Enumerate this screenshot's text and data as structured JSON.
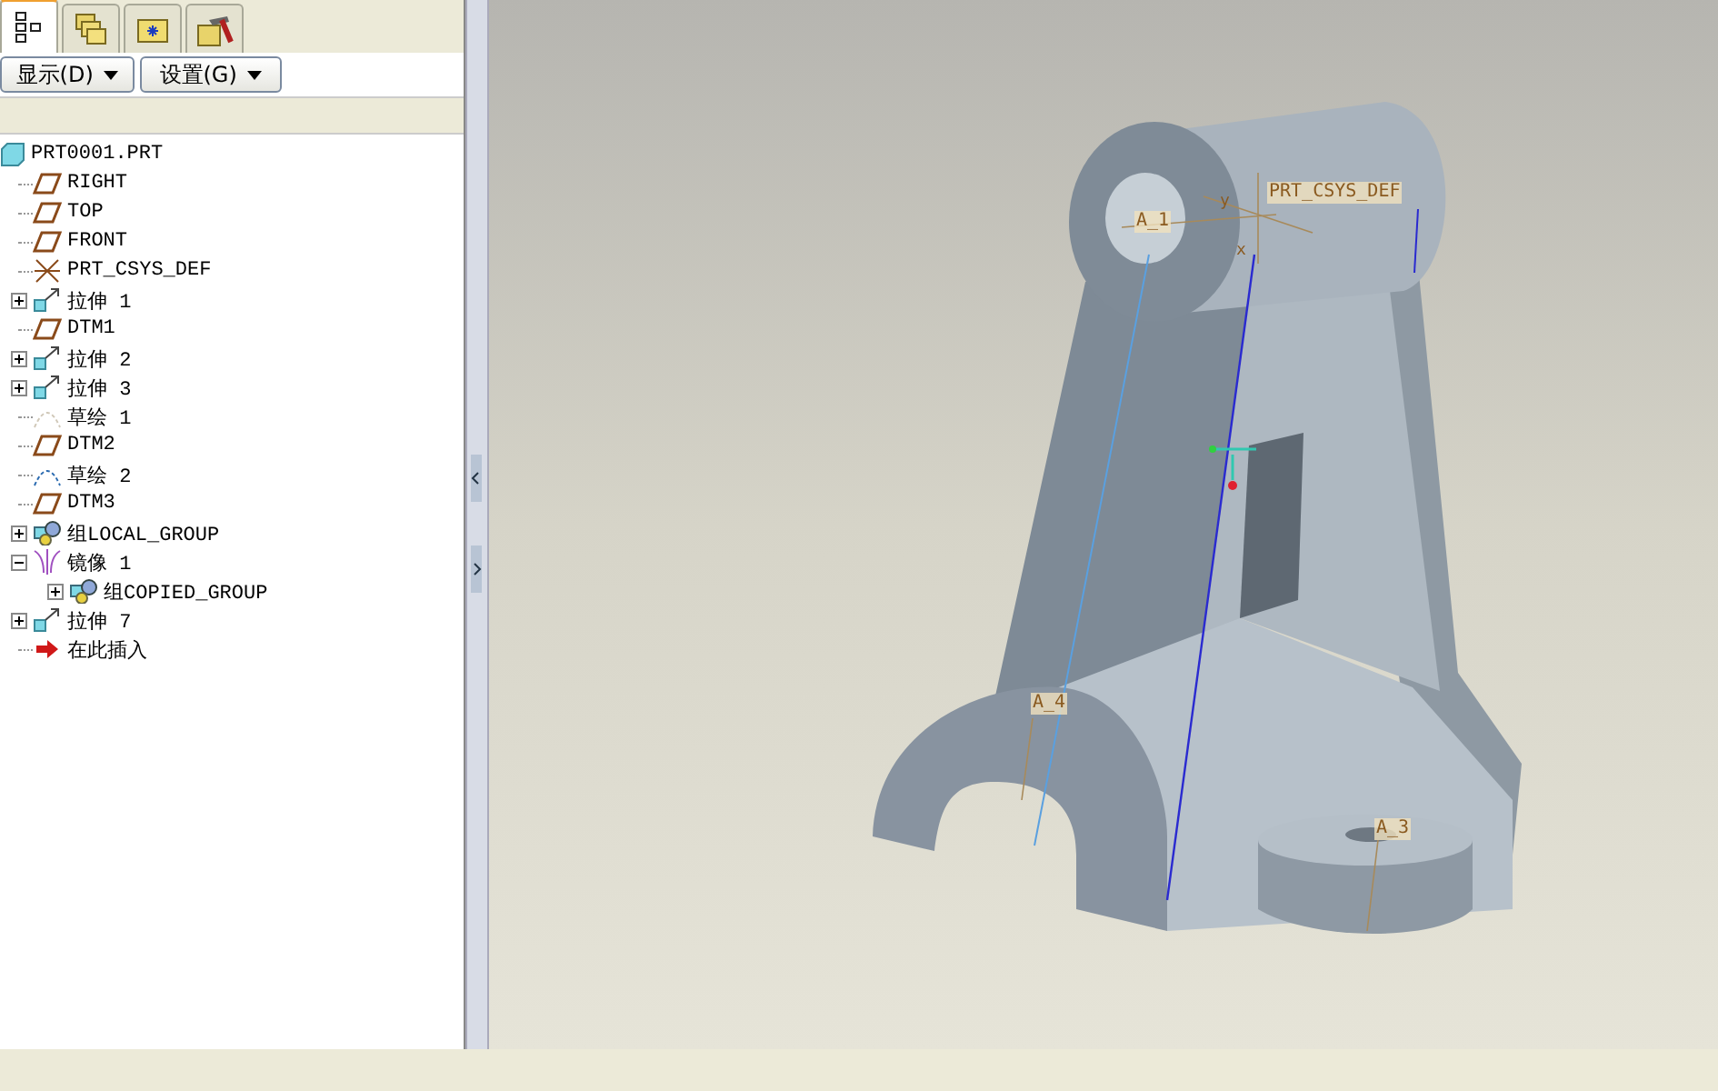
{
  "tabs": [
    {
      "kind": "tree",
      "selected": true
    },
    {
      "kind": "folders",
      "selected": false
    },
    {
      "kind": "favorites",
      "selected": false
    },
    {
      "kind": "tools",
      "selected": false
    }
  ],
  "toolbar": {
    "buttons": [
      "显示(D)",
      "设置(G)"
    ]
  },
  "tree": {
    "label": "PRT0001.PRT",
    "kind": "part",
    "children": [
      {
        "label": "RIGHT",
        "kind": "plane"
      },
      {
        "label": "TOP",
        "kind": "plane"
      },
      {
        "label": "FRONT",
        "kind": "plane"
      },
      {
        "label": "PRT_CSYS_DEF",
        "kind": "csys"
      },
      {
        "label": "拉伸 1",
        "kind": "extrude",
        "expanded": false
      },
      {
        "label": "DTM1",
        "kind": "plane"
      },
      {
        "label": "拉伸 2",
        "kind": "extrude",
        "expanded": false
      },
      {
        "label": "拉伸 3",
        "kind": "extrude",
        "expanded": false
      },
      {
        "label": "草绘 1",
        "kind": "sketch-hidden"
      },
      {
        "label": "DTM2",
        "kind": "plane"
      },
      {
        "label": "草绘 2",
        "kind": "sketch"
      },
      {
        "label": "DTM3",
        "kind": "plane"
      },
      {
        "label": "组LOCAL_GROUP",
        "kind": "group",
        "expanded": false
      },
      {
        "label": "镜像 1",
        "kind": "mirror",
        "expanded": true,
        "children": [
          {
            "label": "组COPIED_GROUP",
            "kind": "group",
            "expanded": false
          }
        ]
      },
      {
        "label": "拉伸 7",
        "kind": "extrude",
        "expanded": false
      },
      {
        "label": "在此插入",
        "kind": "insert"
      }
    ]
  },
  "viewport": {
    "labels": [
      {
        "text": "A_1",
        "kind": "axis"
      },
      {
        "text": "PRT_CSYS_DEF",
        "kind": "csys"
      },
      {
        "text": "y",
        "kind": "y"
      },
      {
        "text": "x",
        "kind": "x"
      },
      {
        "text": "A_4",
        "kind": "axis4"
      },
      {
        "text": "A_3",
        "kind": "axis3"
      }
    ]
  }
}
